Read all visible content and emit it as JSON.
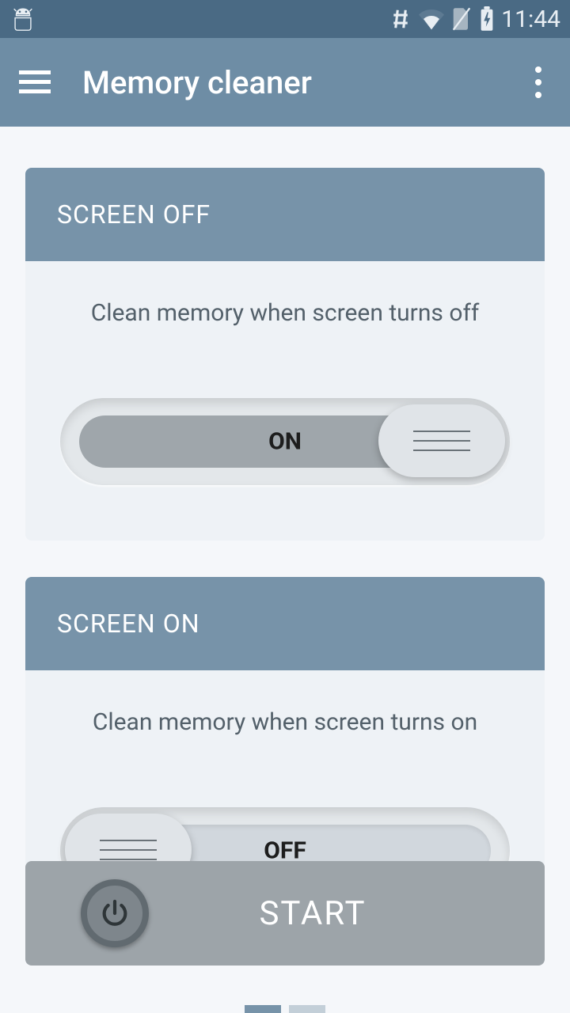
{
  "statusbar": {
    "time": "11:44"
  },
  "appbar": {
    "title": "Memory cleaner"
  },
  "cards": [
    {
      "title": "SCREEN OFF",
      "subtitle": "Clean memory when screen turns off",
      "toggle": {
        "state": "on",
        "label": "ON"
      }
    },
    {
      "title": "SCREEN ON",
      "subtitle": "Clean memory when screen turns on",
      "toggle": {
        "state": "off",
        "label": "OFF"
      }
    }
  ],
  "start": {
    "label": "START"
  },
  "colors": {
    "statusbar": "#4a6a84",
    "appbar": "#6e8da5",
    "cardHeader": "#7793a9",
    "cardBody": "#eef2f6",
    "startBg": "#9da4a9"
  }
}
